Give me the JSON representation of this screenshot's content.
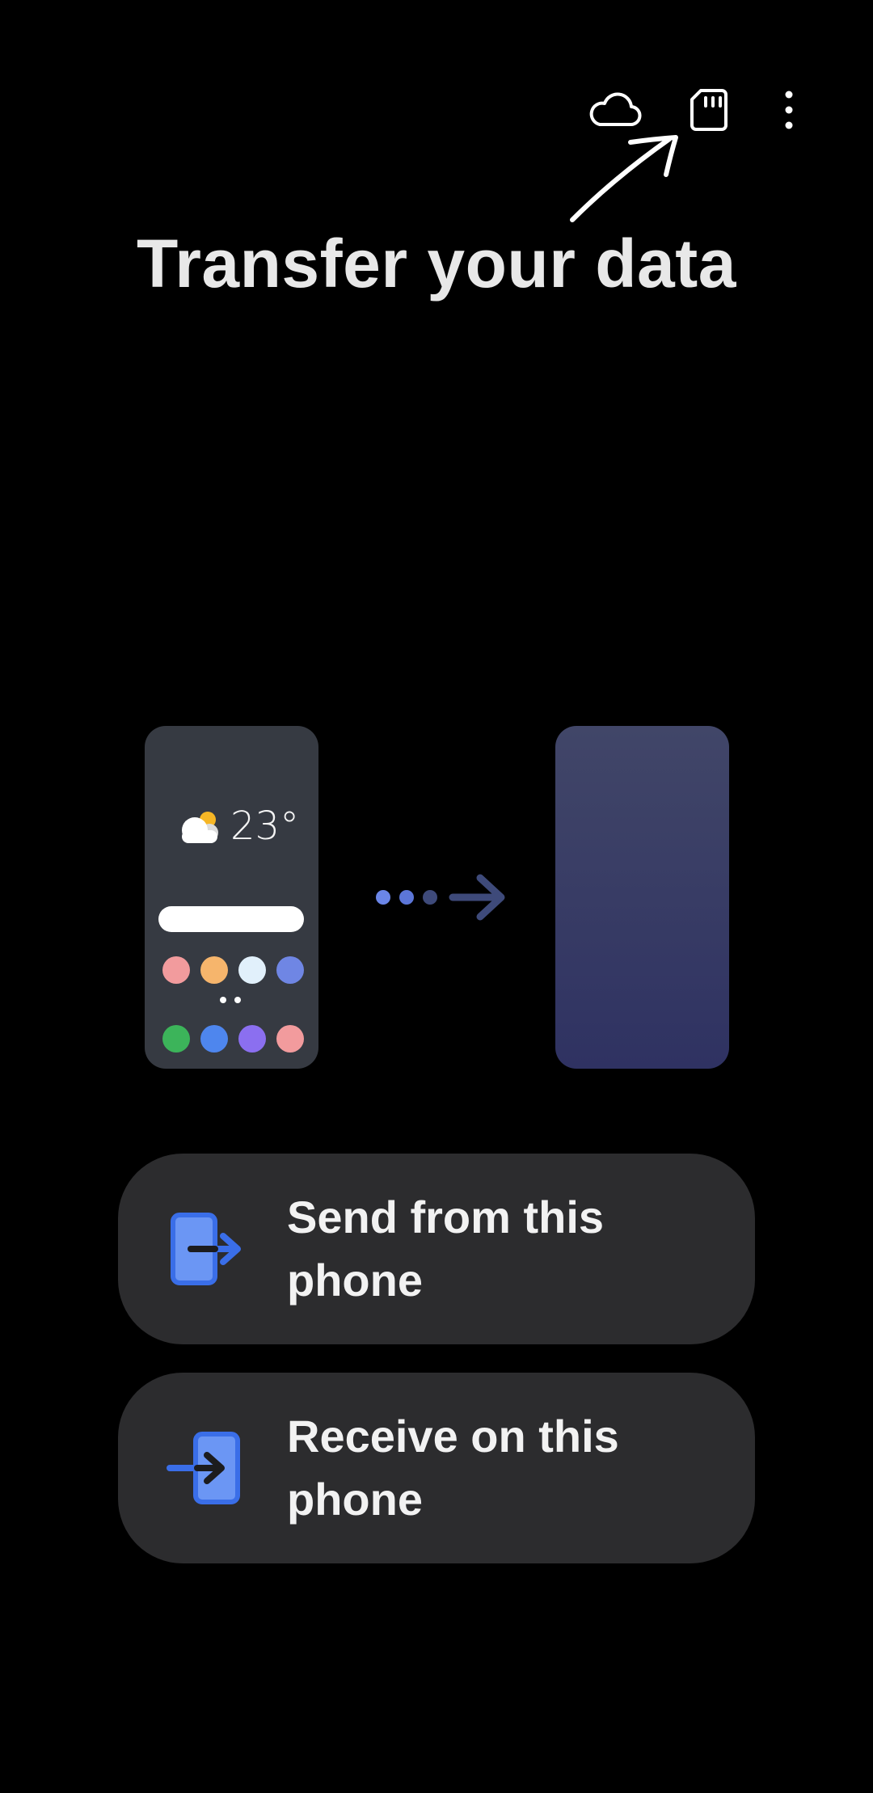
{
  "header": {
    "title": "Transfer your data",
    "icons": [
      "cloud-icon",
      "sd-card-icon",
      "more-options-icon"
    ]
  },
  "illustration": {
    "temperature": "23°",
    "app_colors_row1": [
      "#f29b9d",
      "#f6b56c",
      "#e1f0fb",
      "#6f86e4"
    ],
    "app_colors_row2": [
      "#3cb45a",
      "#4e86ee",
      "#8b6ff0",
      "#f29b9d"
    ]
  },
  "actions": {
    "send_label": "Send from this phone",
    "receive_label": "Receive on this phone"
  },
  "colors": {
    "accent": "#4a7ef0",
    "button_bg": "#2c2c2e",
    "background": "#000000"
  }
}
